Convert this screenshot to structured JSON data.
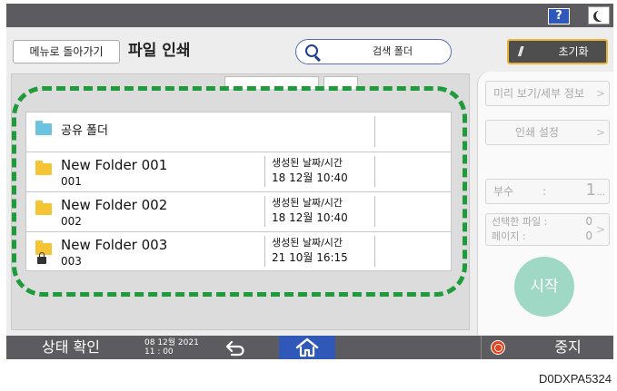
{
  "top_bar": {
    "help_label": "?"
  },
  "header": {
    "back_label": "메뉴로 돌아가기",
    "title": "파일 인쇄",
    "search_label": "검색 폴더",
    "reset_label": "초기화"
  },
  "file_list": {
    "shared": {
      "name": "공유 폴더"
    },
    "rows": [
      {
        "name": "New Folder 001",
        "sub": "001",
        "date_label": "생성된 날짜/시간",
        "date_value": "18 12월  10:40",
        "locked": false
      },
      {
        "name": "New Folder 002",
        "sub": "002",
        "date_label": "생성된 날짜/시간",
        "date_value": "18 12월  10:40",
        "locked": false
      },
      {
        "name": "New Folder 003",
        "sub": "003",
        "date_label": "생성된 날짜/시간",
        "date_value": "21 10월  16:15",
        "locked": true
      }
    ]
  },
  "right_panel": {
    "preview_label": "미리 보기/세부 정보",
    "print_settings_label": "인쇄 설정",
    "copies_label": "부수",
    "copies_colon": ":",
    "copies_value": "1",
    "copies_dots": "...",
    "selected_files_label": "선택한 파일 :",
    "selected_files_value": "0",
    "pages_label": "페이지     :",
    "pages_value": "0",
    "start_label": "시작",
    "chevron": ">"
  },
  "bottom_bar": {
    "status_label": "상태 확인",
    "date": "08 12월 2021",
    "time": "11 : 00",
    "stop_label": "중지"
  },
  "image_code": "D0DXPA5324",
  "colors": {
    "bar": "#5b5b60",
    "accent_blue": "#2f58b8",
    "highlight_green": "#1f9b3c",
    "reset_border": "#e8b53a",
    "start_button": "#9fd9c6",
    "stop_red": "#e2441f"
  }
}
